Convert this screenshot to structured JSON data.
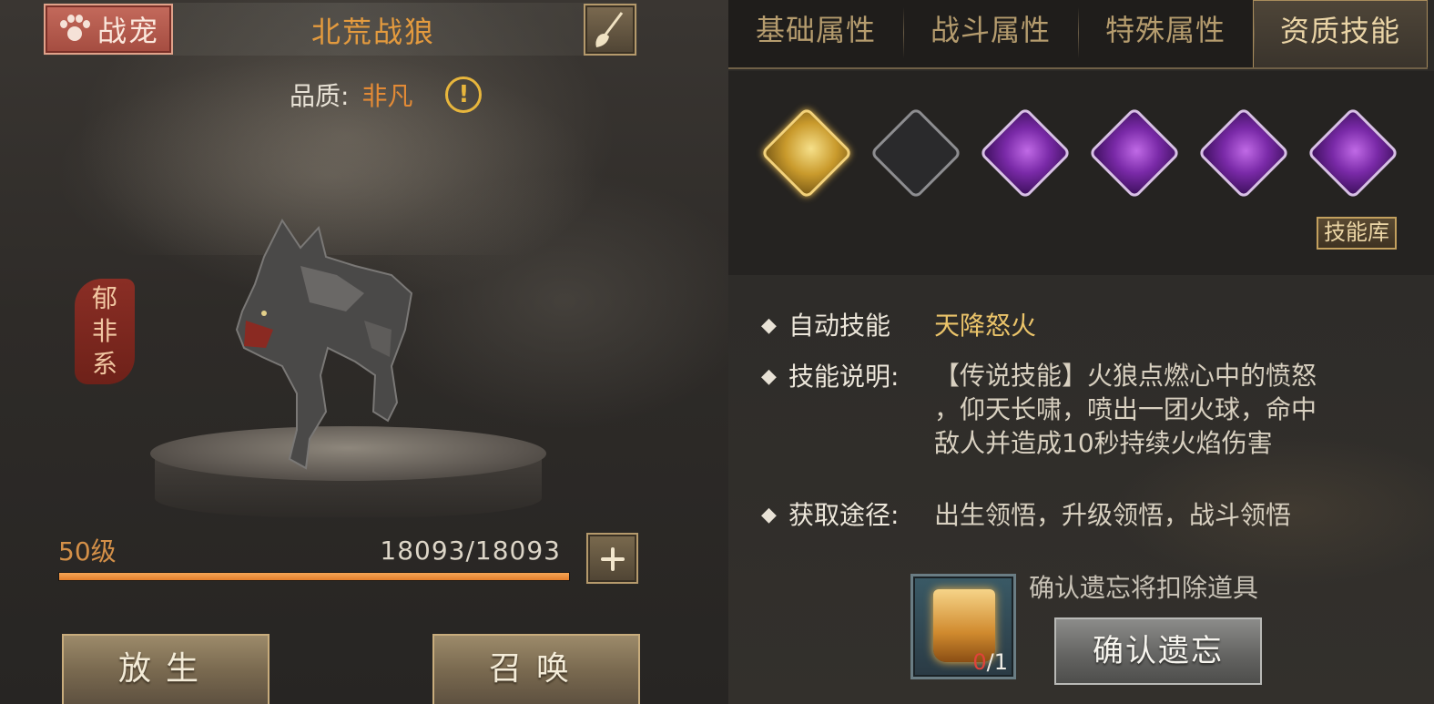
{
  "left": {
    "pet_tab_label": "战宠",
    "pet_name": "北荒战狼",
    "quality_label": "品质:",
    "quality_value": "非凡",
    "series_seal": [
      "郁",
      "非",
      "系"
    ],
    "level_text": "50级",
    "hp_text": "18093/18093",
    "hp_fraction": 1.0,
    "release_label": "放生",
    "summon_label": "召唤"
  },
  "right": {
    "tabs": [
      {
        "label": "基础属性",
        "active": false
      },
      {
        "label": "战斗属性",
        "active": false
      },
      {
        "label": "特殊属性",
        "active": false
      },
      {
        "label": "资质技能",
        "active": true
      }
    ],
    "skill_slots": [
      {
        "type": "gold",
        "icon": "auto-skill-icon"
      },
      {
        "type": "empty",
        "icon": "empty-slot"
      },
      {
        "type": "purple",
        "icon": "purple-skill-icon"
      },
      {
        "type": "purple",
        "icon": "purple-skill-icon"
      },
      {
        "type": "purple",
        "icon": "purple-skill-icon"
      },
      {
        "type": "purple",
        "icon": "purple-skill-icon"
      }
    ],
    "skill_library_label": "技能库",
    "auto_skill": {
      "bullet": "◆",
      "label": "自动技能",
      "value": "天降怒火"
    },
    "skill_desc": {
      "bullet": "◆",
      "label": "技能说明:",
      "lines": [
        "【传说技能】火狼点燃心中的愤怒",
        "，仰天长啸，喷出一团火球，命中",
        "敌人并造成10秒持续火焰伤害"
      ]
    },
    "obtain": {
      "bullet": "◆",
      "label": "获取途径:",
      "value": "出生领悟，升级领悟，战斗领悟"
    },
    "cost_have": "0",
    "cost_sep_need": "/1",
    "forget_hint": "确认遗忘将扣除道具",
    "confirm_label": "确认遗忘"
  },
  "colors": {
    "accent_gold": "#e39a3e",
    "hp_bar": "#f09a44",
    "pet_tab_red": "#b45a4c",
    "cost_have_red": "#e0433a"
  }
}
